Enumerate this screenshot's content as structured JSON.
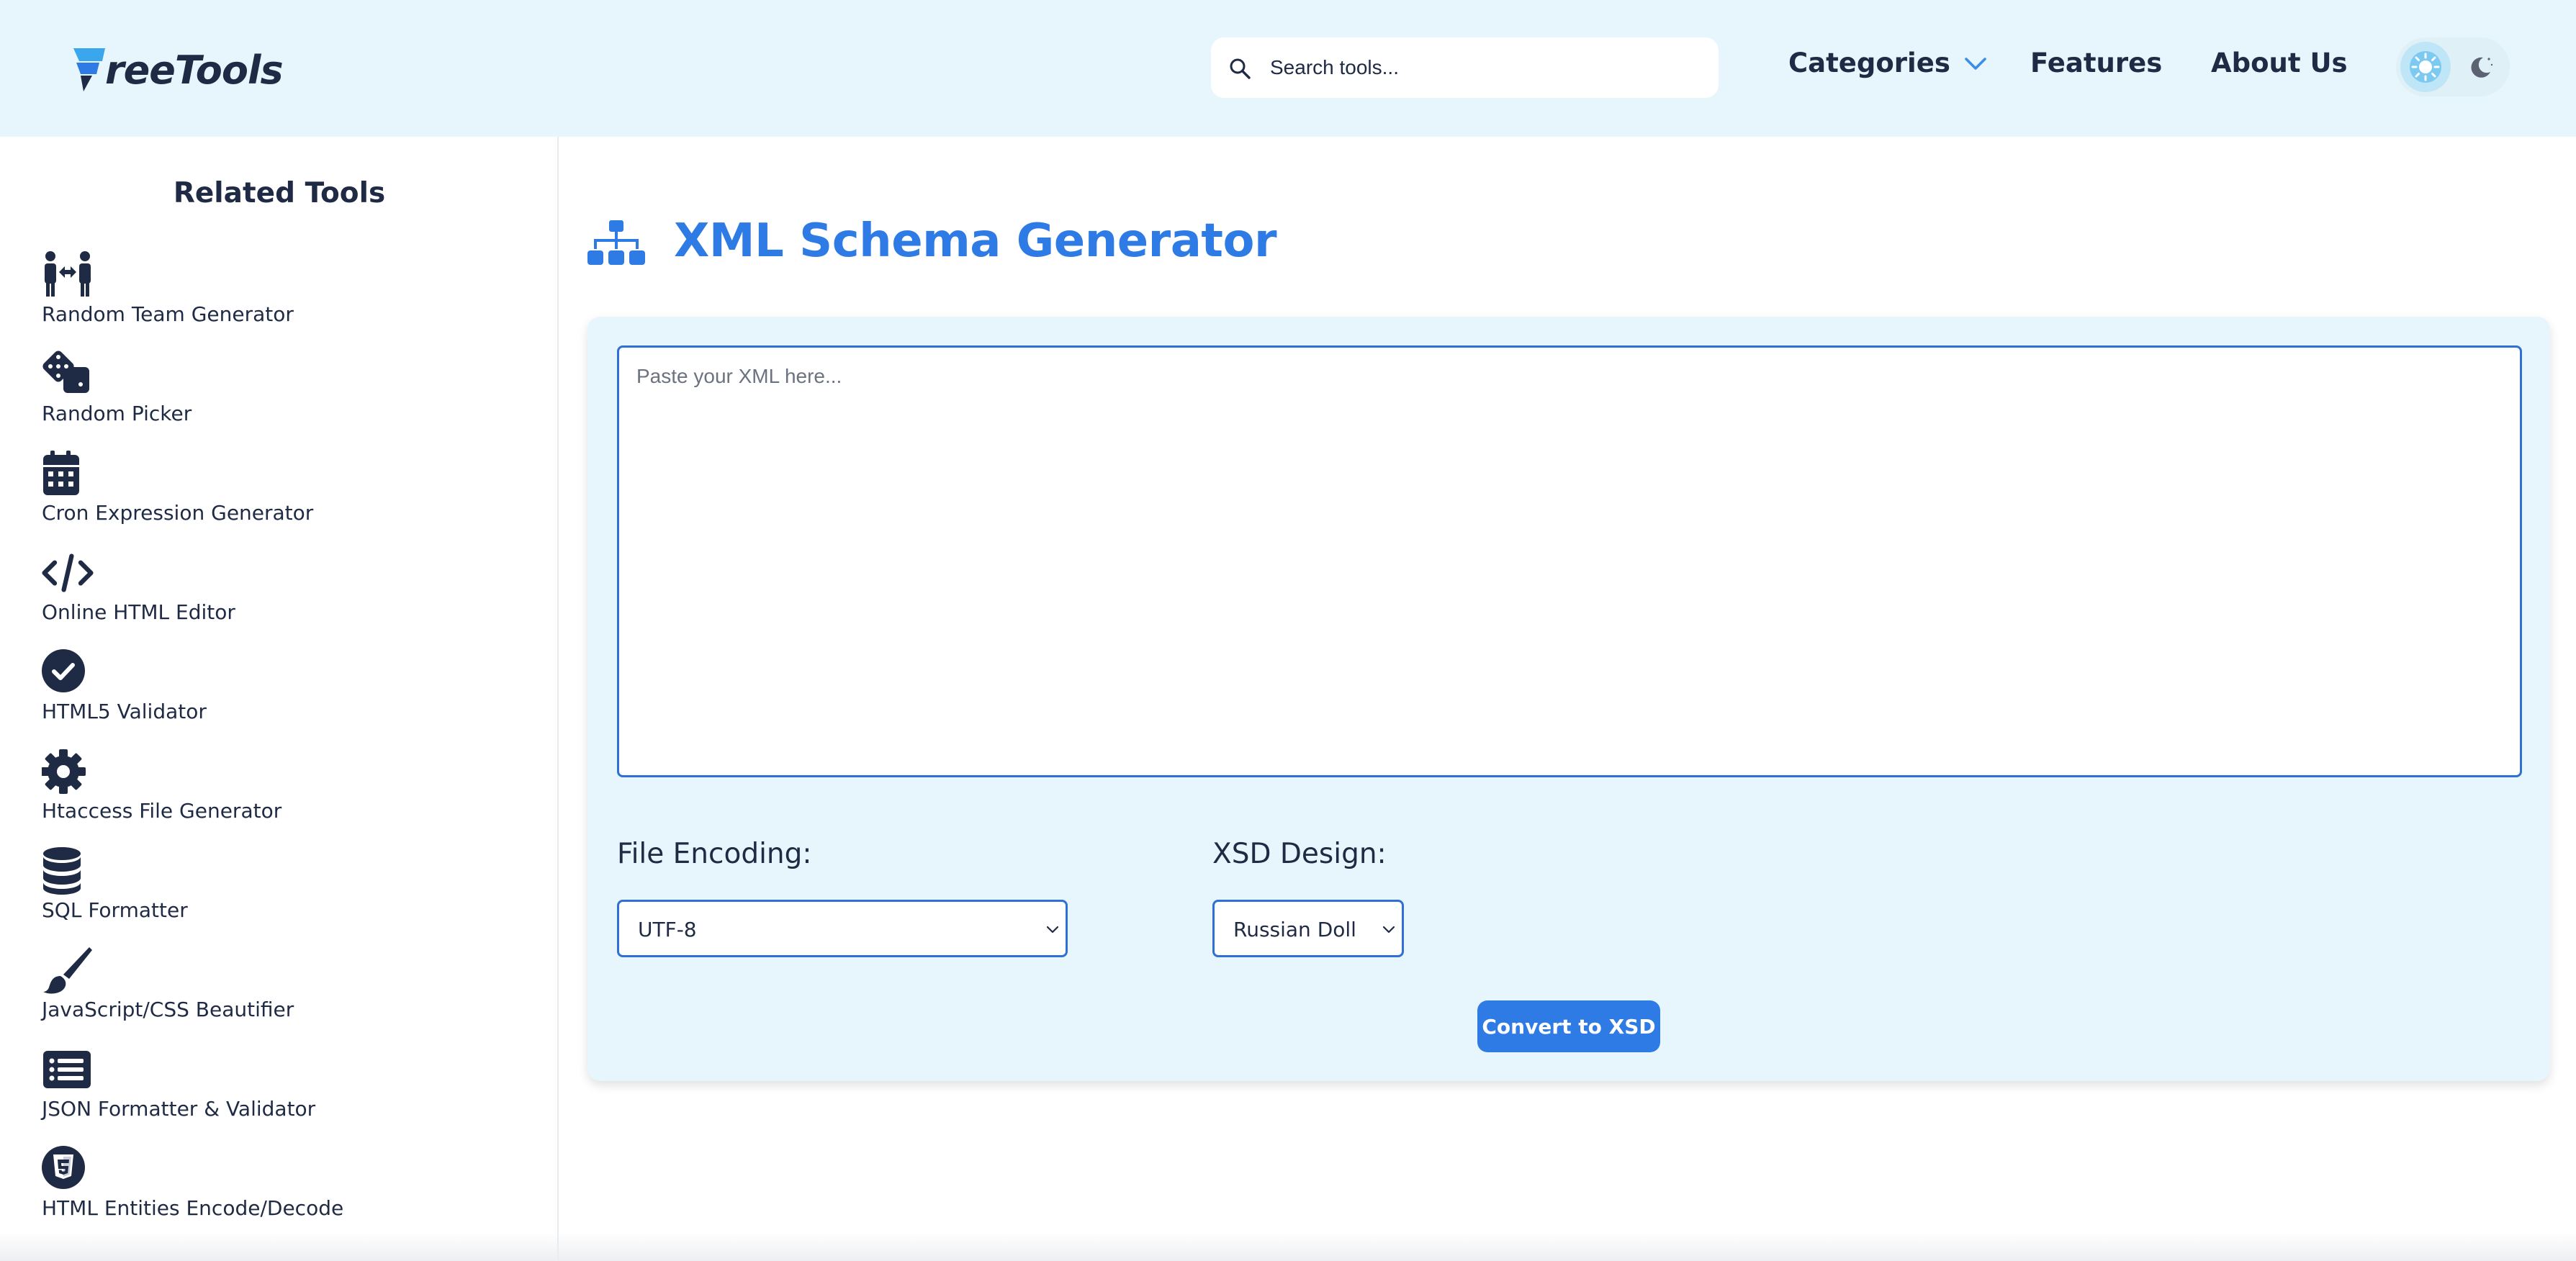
{
  "header": {
    "logo_text": "reeTools",
    "search": {
      "placeholder": "Search tools..."
    },
    "nav": {
      "categories": "Categories",
      "features": "Features",
      "about": "About Us"
    }
  },
  "sidebar": {
    "title": "Related Tools",
    "items": [
      {
        "label": "Random Team Generator",
        "icon": "people-arrows-icon"
      },
      {
        "label": "Random Picker",
        "icon": "dice-icon"
      },
      {
        "label": "Cron Expression Generator",
        "icon": "calendar-icon"
      },
      {
        "label": "Online HTML Editor",
        "icon": "code-icon"
      },
      {
        "label": "HTML5 Validator",
        "icon": "check-circle-icon"
      },
      {
        "label": "Htaccess File Generator",
        "icon": "gear-icon"
      },
      {
        "label": "SQL Formatter",
        "icon": "database-icon"
      },
      {
        "label": "JavaScript/CSS Beautifier",
        "icon": "brush-icon"
      },
      {
        "label": "JSON Formatter & Validator",
        "icon": "list-icon"
      },
      {
        "label": "HTML Entities Encode/Decode",
        "icon": "html5-icon"
      }
    ]
  },
  "main": {
    "title": "XML Schema Generator",
    "xml_placeholder": "Paste your XML here...",
    "encoding_label": "File Encoding:",
    "encoding_value": "UTF-8",
    "design_label": "XSD Design:",
    "design_value": "Russian Doll",
    "convert_label": "Convert to XSD"
  },
  "colors": {
    "header_bg": "#e6f6fc",
    "accent": "#2f7be6",
    "text": "#1f2a44"
  }
}
